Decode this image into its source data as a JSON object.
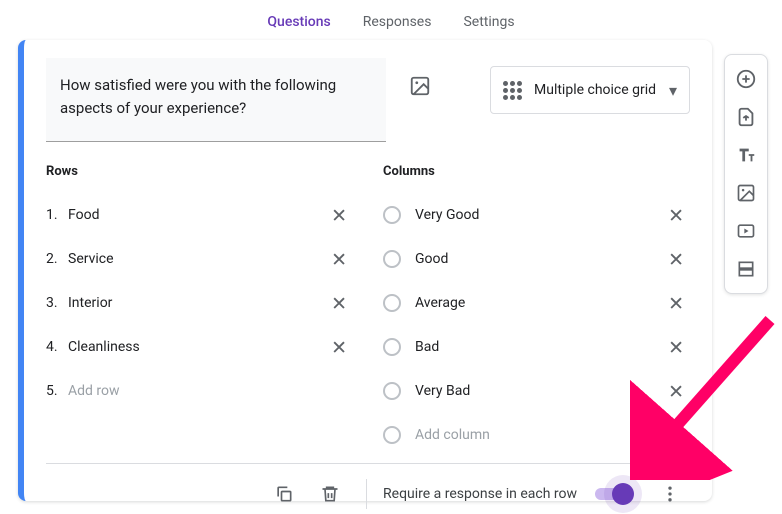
{
  "tabs": {
    "questions": "Questions",
    "responses": "Responses",
    "settings": "Settings"
  },
  "question": {
    "text": "How satisfied were you with the following aspects of your experience?",
    "type": "Multiple choice grid"
  },
  "rowsHeader": "Rows",
  "columnsHeader": "Columns",
  "rows": [
    {
      "n": "1.",
      "label": "Food"
    },
    {
      "n": "2.",
      "label": "Service"
    },
    {
      "n": "3.",
      "label": "Interior"
    },
    {
      "n": "4.",
      "label": "Cleanliness"
    }
  ],
  "addRow": {
    "n": "5.",
    "label": "Add row"
  },
  "columns": [
    {
      "label": "Very Good"
    },
    {
      "label": "Good"
    },
    {
      "label": "Average"
    },
    {
      "label": "Bad"
    },
    {
      "label": "Very Bad"
    }
  ],
  "addColumn": "Add column",
  "footer": {
    "require": "Require a response in each row"
  }
}
